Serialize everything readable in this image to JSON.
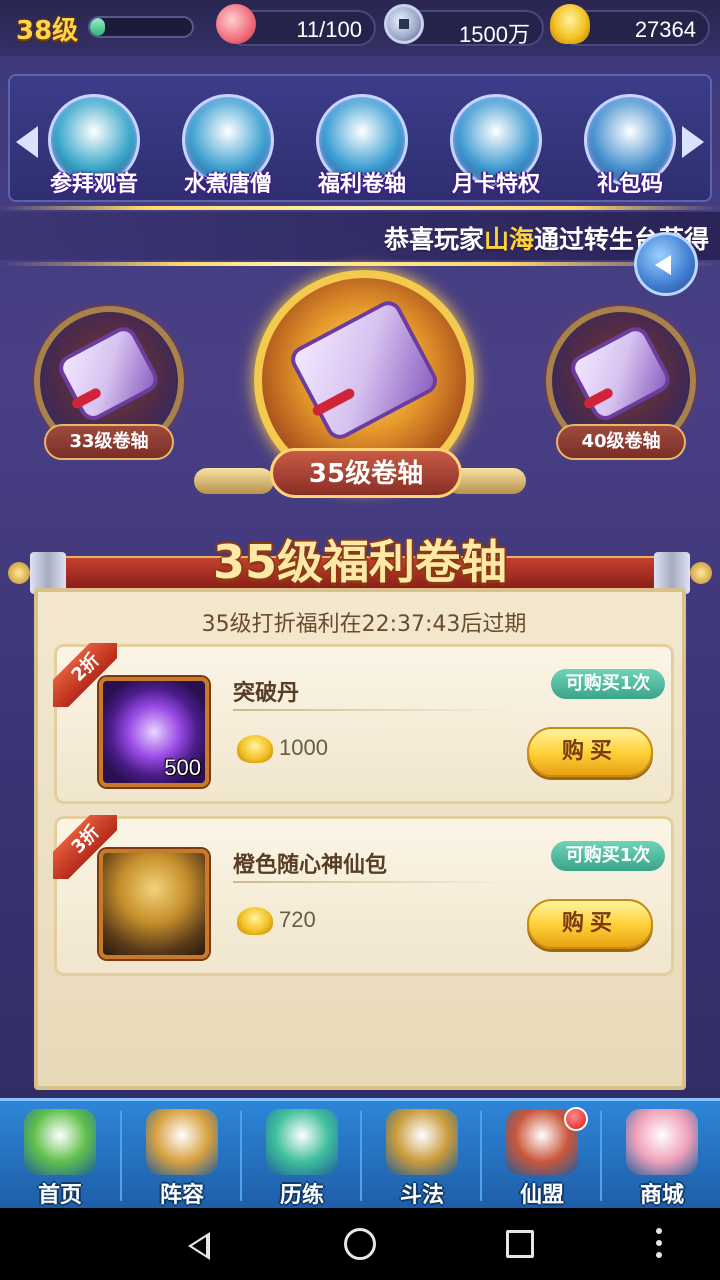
{
  "topbar": {
    "level": "38级",
    "exp_fraction": 0.15,
    "stamina": "11/100",
    "coins": "1500万",
    "ingots": "27364",
    "icons": [
      "peach-icon",
      "coin-icon",
      "gold-ingot-icon"
    ]
  },
  "menu": {
    "items": [
      {
        "label": "参拜观音",
        "icon": "guanyin-icon",
        "color": "#3aa7c9"
      },
      {
        "label": "水煮唐僧",
        "icon": "monk-icon",
        "color": "#3fa1d1"
      },
      {
        "label": "福利卷轴",
        "icon": "scroll-icon",
        "color": "#3d9fd3"
      },
      {
        "label": "月卡特权",
        "icon": "month-card-icon",
        "color": "#409bd1"
      },
      {
        "label": "礼包码",
        "icon": "gift-icon",
        "color": "#4a93cf"
      }
    ]
  },
  "marquee": {
    "prefix": "恭喜玩家",
    "player": "山海",
    "suffix": "通过转生台获得"
  },
  "scrolls": {
    "left": "33级卷轴",
    "center": "35级卷轴",
    "right": "40级卷轴"
  },
  "panel": {
    "title": "35级福利卷轴",
    "expiry": "35级打折福利在22:37:43后过期",
    "items": [
      {
        "discount": "2折",
        "name": "突破丹",
        "count": "500",
        "limit": "可购买1次",
        "price": "1000",
        "buy_label": "购买"
      },
      {
        "discount": "3折",
        "name": "橙色随心神仙包",
        "count": "",
        "limit": "可购买1次",
        "price": "720",
        "buy_label": "购买"
      }
    ]
  },
  "nav": {
    "items": [
      {
        "label": "首页",
        "icon": "home-island-icon",
        "color": "#5fbf4a"
      },
      {
        "label": "阵容",
        "icon": "formation-icon",
        "color": "#d8a040"
      },
      {
        "label": "历练",
        "icon": "gourd-icon",
        "color": "#3fbf9a"
      },
      {
        "label": "斗法",
        "icon": "helmet-icon",
        "color": "#c99a3a"
      },
      {
        "label": "仙盟",
        "icon": "palace-icon",
        "color": "#c9563a"
      },
      {
        "label": "商城",
        "icon": "shop-girl-icon",
        "color": "#f0a0b8"
      }
    ]
  },
  "colors": {
    "accent_gold": "#ffd23a",
    "highlight_name": "#ffd23a",
    "limit_badge": "#3aa48b"
  }
}
